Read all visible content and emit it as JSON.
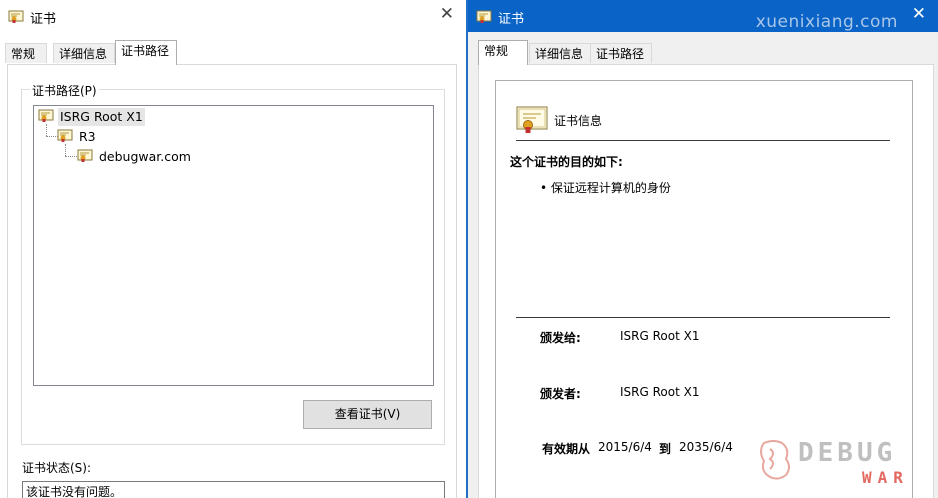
{
  "left_window": {
    "title": "证书",
    "tabs": [
      "常规",
      "详细信息",
      "证书路径"
    ],
    "active_tab": 2,
    "cert_path_label": "证书路径(P)",
    "tree": [
      {
        "label": "ISRG Root X1",
        "selected": true
      },
      {
        "label": "R3",
        "selected": false
      },
      {
        "label": "debugwar.com",
        "selected": false
      }
    ],
    "view_cert_button": "查看证书(V)",
    "status_label": "证书状态(S):",
    "status_text": "该证书没有问题。"
  },
  "right_window": {
    "title": "证书",
    "watermark": "xuenixiang.com",
    "tabs": [
      "常规",
      "详细信息",
      "证书路径"
    ],
    "active_tab": 0,
    "cert_info_heading": "证书信息",
    "purpose_heading": "这个证书的目的如下:",
    "purposes": [
      "保证远程计算机的身份"
    ],
    "issued_to_label": "颁发给:",
    "issued_to_value": "ISRG Root X1",
    "issued_by_label": "颁发者:",
    "issued_by_value": "ISRG Root X1",
    "valid_label": "有效期从",
    "valid_from": "2015/6/4",
    "valid_to_label": "到",
    "valid_to": "2035/6/4"
  },
  "logo": {
    "line1": "DEBUG",
    "line2": "WAR"
  },
  "colors": {
    "titlebar_active": "#0a64c8",
    "logo_red": "#e36a60",
    "logo_gray": "#bfbfbf"
  }
}
